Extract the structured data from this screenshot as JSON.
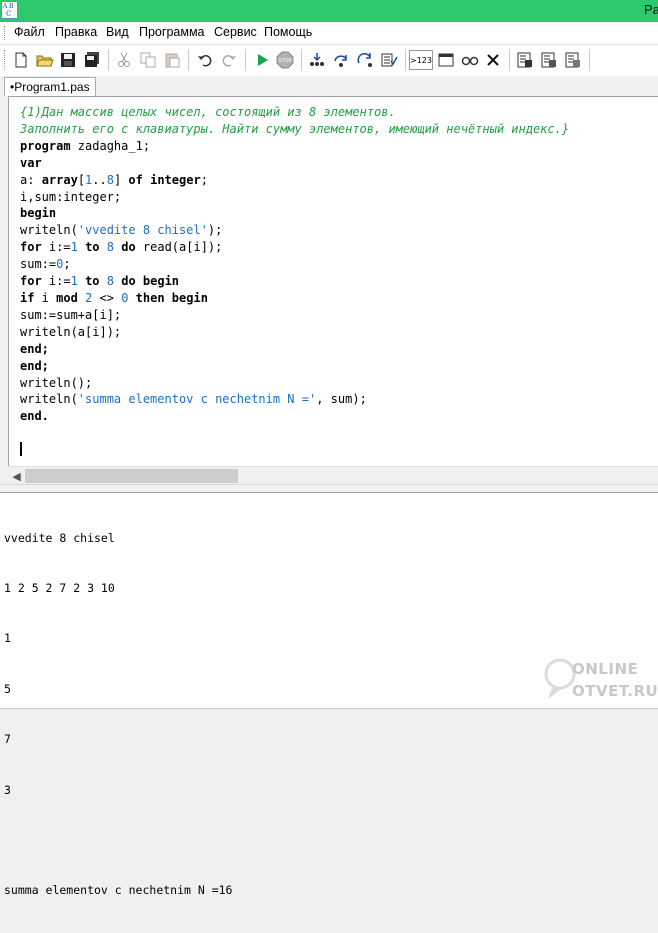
{
  "window": {
    "title": "Pa"
  },
  "menu": {
    "items": [
      "Файл",
      "Правка",
      "Вид",
      "Программа",
      "Сервис",
      "Помощь"
    ]
  },
  "toolbar": {
    "icons": [
      "new-file-icon",
      "open-file-icon",
      "save-icon",
      "save-all-icon",
      "cut-icon",
      "copy-icon",
      "paste-icon",
      "undo-icon",
      "redo-icon",
      "run-icon",
      "stop-icon",
      "step-into-icon",
      "step-over-icon",
      "step-out-icon",
      "debug-list-icon",
      "output-format-icon",
      "window-icon",
      "glasses-icon",
      "close-x-icon",
      "build-icon",
      "compile-icon",
      "format-icon"
    ],
    "format_label": ">123"
  },
  "tabs": [
    {
      "label": "•Program1.pas"
    }
  ],
  "editor": {
    "lines": [
      "{1)Дан массив целых чисел, состоящий из 8 элементов.",
      "Заполнить его с клавиатуры. Найти сумму элементов, имеющий нечётный индекс.}",
      "program zadagha_1;",
      "var",
      "a: array[1..8] of integer;",
      "i,sum:integer;",
      "begin",
      "writeln('vvedite 8 chisel');",
      "for i:=1 to 8 do read(a[i]);",
      "sum:=0;",
      "for i:=1 to 8 do begin",
      "if i mod 2 <> 0 then begin",
      "sum:=sum+a[i];",
      "writeln(a[i]);",
      "end;",
      "end;",
      "writeln();",
      "writeln('summa elementov c nechetnim N =', sum);",
      "end."
    ]
  },
  "output": {
    "lines": [
      "vvedite 8 chisel",
      "1 2 5 2 7 2 3 10",
      "1",
      "5",
      "7",
      "3",
      "",
      "summa elementov c nechetnim N =16"
    ]
  },
  "watermark": {
    "line1": "ONLINE",
    "line2": "OTVET.RU"
  },
  "colors": {
    "titlebar": "#2ec96c",
    "comment": "#23a046",
    "string": "#1d6fc2"
  }
}
